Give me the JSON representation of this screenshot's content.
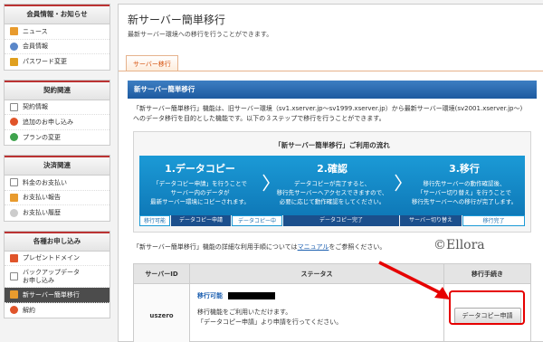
{
  "sidebar": {
    "sections": [
      {
        "title": "会員情報・お知らせ",
        "items": [
          "ニュース",
          "会員情報",
          "パスワード変更"
        ]
      },
      {
        "title": "契約関連",
        "items": [
          "契約情報",
          "追加のお申し込み",
          "プランの変更"
        ]
      },
      {
        "title": "決済関連",
        "items": [
          "料金のお支払い",
          "お支払い報告",
          "お支払い履歴"
        ]
      },
      {
        "title": "各種お申し込み",
        "items": [
          "プレゼントドメイン",
          "バックアップデータ",
          "お申し込み",
          "新サーバー簡単移行",
          "解約"
        ]
      }
    ],
    "backup_line1": "バックアップデータ",
    "backup_line2": "お申し込み"
  },
  "main": {
    "title": "新サーバー簡単移行",
    "description": "最新サーバー環境への移行を行うことができます。",
    "tab": "サーバー移行",
    "section_title": "新サーバー簡単移行",
    "intro_line1": "「新サーバー簡単移行」機能は、旧サーバー環境（sv1.xserver.jp～sv1999.xserver.jp）から最新サーバー環境(sv2001.xserver.jp～)",
    "intro_line2": "へのデータ移行を目的とした機能です。以下の３ステップで移行を行うことができます。",
    "flow": {
      "title": "「新サーバー簡単移行」ご利用の流れ",
      "steps": [
        {
          "heading": "1.データコピー",
          "l1": "「データコピー申請」を行うことで",
          "l2": "サーバー内のデータが",
          "l3": "最新サーバー環境にコピーされます。"
        },
        {
          "heading": "2.確認",
          "l1": "データコピーが完了すると、",
          "l2": "移行先サーバーへアクセスできますので、",
          "l3": "必要に応じて動作確認をしてください。"
        },
        {
          "heading": "3.移行",
          "l1": "移行先サーバーの動作確認後、",
          "l2": "「サーバー切り替え」を行うことで",
          "l3": "移行先サーバーへの移行が完了します。"
        }
      ],
      "stages": [
        "移行可能",
        "データコピー申請",
        "データコピー中",
        "データコピー完了",
        "サーバー切り替え",
        "移行完了"
      ]
    },
    "manual_pre": "「新サーバー簡単移行」機能の詳細な利用手順については",
    "manual_link": "マニュアル",
    "manual_post": "をご参照ください。",
    "copyright": "©Ellora",
    "table": {
      "headers": [
        "サーバーID",
        "ステータス",
        "移行手続き"
      ],
      "row": {
        "server_id": "uszero",
        "status_label": "移行可能",
        "status_line1": "移行機能をご利用いただけます。",
        "status_line2": "「データコピー申請」より申請を行ってください。",
        "button": "データコピー申請"
      }
    }
  },
  "colors": {
    "accent_blue": "#1c5fb0",
    "flow_blue": "#1b9ad6",
    "tab_orange": "#d64f0a",
    "highlight_red": "#e60000",
    "active_nav": "#4c4c4c"
  }
}
